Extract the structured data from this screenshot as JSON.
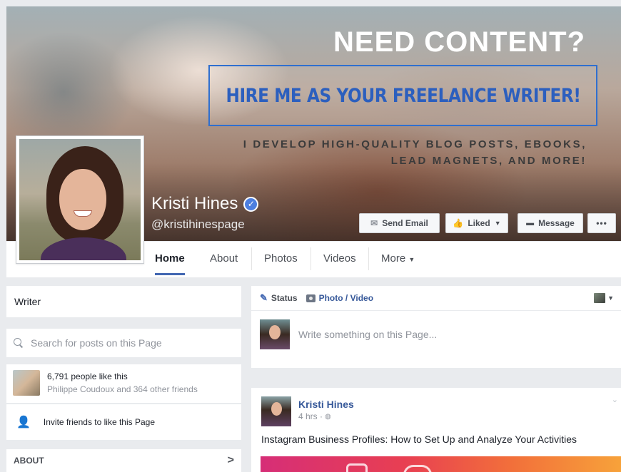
{
  "cover": {
    "headline": "NEED CONTENT?",
    "banner": "HIRE ME AS YOUR FREELANCE WRITER!",
    "subtext_line1": "I DEVELOP HIGH-QUALITY BLOG POSTS, EBOOKS,",
    "subtext_line2": "LEAD MAGNETS, AND MORE!"
  },
  "page": {
    "name": "Kristi Hines",
    "handle": "@kristihinespage"
  },
  "actions": {
    "send_email": "Send Email",
    "liked": "Liked",
    "message": "Message",
    "more": "•••"
  },
  "nav": {
    "tabs": [
      "Home",
      "About",
      "Photos",
      "Videos",
      "More"
    ],
    "active": "Home"
  },
  "sidebar": {
    "category": "Writer",
    "search_placeholder": "Search for posts on this Page",
    "likes_count": "6,791 people like this",
    "likes_friends": "Philippe Coudoux and 364 other friends",
    "invite": "Invite friends to like this Page",
    "about_heading": "ABOUT"
  },
  "composer": {
    "status_tab": "Status",
    "photo_tab": "Photo / Video",
    "placeholder": "Write something on this Page..."
  },
  "post": {
    "author": "Kristi Hines",
    "time": "4 hrs ·",
    "text": "Instagram Business Profiles: How to Set Up and Analyze Your Activities"
  },
  "colors": {
    "accent": "#4267b2",
    "link": "#365899",
    "banner_blue": "#2c5fbe"
  }
}
